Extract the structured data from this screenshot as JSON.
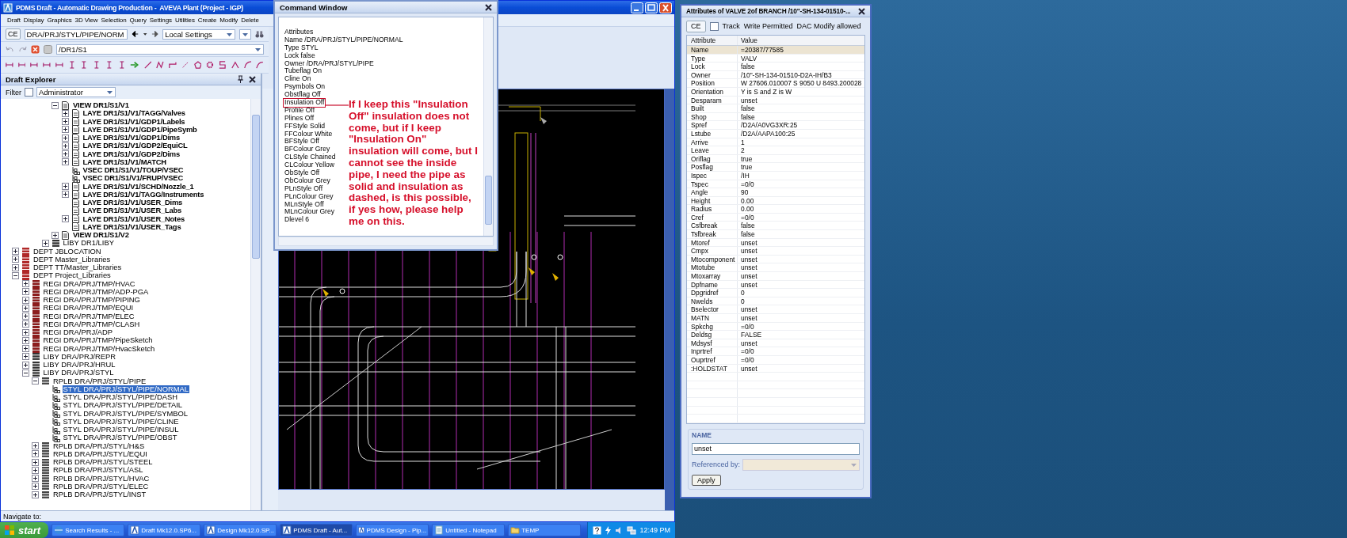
{
  "main_window": {
    "title": "PDMS Draft - Automatic Drawing Production -  AVEVA Plant (Project - IGP)",
    "menu": [
      "Draft",
      "Display",
      "Graphics",
      "3D View",
      "Selection",
      "Query",
      "Settings",
      "Utilities",
      "Create",
      "Modify",
      "Delete"
    ],
    "toolbar": {
      "ce_button": "CE",
      "element_combo": "DRA/PRJ/STYL/PIPE/NORM",
      "settings_combo": "Local Settings",
      "path_combo": "/DR1/S1"
    },
    "draft_explorer": {
      "title": "Draft Explorer",
      "filter_label": "Filter",
      "filter_checked": false,
      "filter_combo": "Administrator",
      "tree": [
        {
          "children": [
            {
              "children": [
                {
                  "children": [
                    {
                      "children": [
                        {
                          "label": "VIEW DR1/S1/V1",
                          "kind": "view",
                          "selected": false,
                          "expanded": true,
                          "children": [
                            {
                              "label": "LAYE DR1/S1/V1/TAGG/Valves",
                              "kind": "layer",
                              "selected": false,
                              "expanded": false
                            },
                            {
                              "label": "LAYE DR1/S1/V1/GDP1/Labels",
                              "kind": "layer",
                              "selected": false,
                              "expanded": false
                            },
                            {
                              "label": "LAYE DR1/S1/V1/GDP1/PipeSymb",
                              "kind": "layer",
                              "selected": false,
                              "expanded": false
                            },
                            {
                              "label": "LAYE DR1/S1/V1/GDP1/Dims",
                              "kind": "layer",
                              "selected": false,
                              "expanded": false
                            },
                            {
                              "label": "LAYE DR1/S1/V1/GDP2/EquiCL",
                              "kind": "layer",
                              "selected": false,
                              "expanded": false
                            },
                            {
                              "label": "LAYE DR1/S1/V1/GDP2/Dims",
                              "kind": "layer",
                              "selected": false,
                              "expanded": false
                            },
                            {
                              "label": "LAYE DR1/S1/V1/MATCH",
                              "kind": "layer",
                              "selected": false,
                              "expanded": false
                            },
                            {
                              "label": "VSEC DR1/S1/V1/TOUP/VSEC",
                              "kind": "vsec",
                              "selected": false
                            },
                            {
                              "label": "VSEC DR1/S1/V1/FRUP/VSEC",
                              "kind": "vsec",
                              "selected": false
                            },
                            {
                              "label": "LAYE DR1/S1/V1/SCHD/Nozzle_1",
                              "kind": "layer",
                              "selected": false,
                              "expanded": false
                            },
                            {
                              "label": "LAYE DR1/S1/V1/TAGG/Instruments",
                              "kind": "layer",
                              "selected": false,
                              "expanded": false
                            },
                            {
                              "label": "LAYE DR1/S1/V1/USER_Dims",
                              "kind": "layer",
                              "selected": false
                            },
                            {
                              "label": "LAYE DR1/S1/V1/USER_Labs",
                              "kind": "layer",
                              "selected": false
                            },
                            {
                              "label": "LAYE DR1/S1/V1/USER_Notes",
                              "kind": "layer",
                              "selected": false,
                              "expanded": false
                            },
                            {
                              "label": "LAYE DR1/S1/V1/USER_Tags",
                              "kind": "layer",
                              "selected": false
                            }
                          ]
                        },
                        {
                          "label": "VIEW DR1/S1/V2",
                          "kind": "view",
                          "selected": false,
                          "expanded": false
                        }
                      ]
                    },
                    {
                      "label": "LIBY DR1/LIBY",
                      "kind": "liby",
                      "selected": false,
                      "expanded": false
                    }
                  ]
                }
              ]
            }
          ]
        },
        {
          "label": "DEPT JBLOCATION",
          "kind": "dept",
          "selected": false,
          "expanded": false
        },
        {
          "label": "DEPT Master_Libraries",
          "kind": "dept",
          "selected": false,
          "expanded": false
        },
        {
          "label": "DEPT TT/Master_Libraries",
          "kind": "dept",
          "selected": false,
          "expanded": false
        },
        {
          "label": "DEPT Project_Libraries",
          "kind": "dept",
          "selected": false,
          "expanded": true,
          "children": [
            {
              "label": "REGI DRA/PRJ/TMP/HVAC",
              "kind": "regi",
              "selected": false,
              "expanded": false
            },
            {
              "label": "REGI DRA/PRJ/TMP/ADP-PGA",
              "kind": "regi",
              "selected": false,
              "expanded": false
            },
            {
              "label": "REGI DRA/PRJ/TMP/PIPING",
              "kind": "regi",
              "selected": false,
              "expanded": false
            },
            {
              "label": "REGI DRA/PRJ/TMP/EQUI",
              "kind": "regi",
              "selected": false,
              "expanded": false
            },
            {
              "label": "REGI DRA/PRJ/TMP/ELEC",
              "kind": "regi",
              "selected": false,
              "expanded": false
            },
            {
              "label": "REGI DRA/PRJ/TMP/CLASH",
              "kind": "regi",
              "selected": false,
              "expanded": false
            },
            {
              "label": "REGI DRA/PRJ/ADP",
              "kind": "regi",
              "selected": false,
              "expanded": false
            },
            {
              "label": "REGI DRA/PRJ/TMP/PipeSketch",
              "kind": "regi",
              "selected": false,
              "expanded": false
            },
            {
              "label": "REGI DRA/PRJ/TMP/HvacSketch",
              "kind": "regi",
              "selected": false,
              "expanded": false
            },
            {
              "label": "LIBY DRA/PRJ/REPR",
              "kind": "liby",
              "selected": false,
              "expanded": false
            },
            {
              "label": "LIBY DRA/PRJ/HRUL",
              "kind": "liby",
              "selected": false,
              "expanded": false
            },
            {
              "label": "LIBY DRA/PRJ/STYL",
              "kind": "liby",
              "selected": false,
              "expanded": true,
              "children": [
                {
                  "label": "RPLB DRA/PRJ/STYL/PIPE",
                  "kind": "rplb",
                  "selected": false,
                  "expanded": true,
                  "children": [
                    {
                      "label": "STYL DRA/PRJ/STYL/PIPE/NORMAL",
                      "kind": "styl",
                      "selected": true
                    },
                    {
                      "label": "STYL DRA/PRJ/STYL/PIPE/DASH",
                      "kind": "styl",
                      "selected": false
                    },
                    {
                      "label": "STYL DRA/PRJ/STYL/PIPE/DETAIL",
                      "kind": "styl",
                      "selected": false
                    },
                    {
                      "label": "STYL DRA/PRJ/STYL/PIPE/SYMBOL",
                      "kind": "styl",
                      "selected": false
                    },
                    {
                      "label": "STYL DRA/PRJ/STYL/PIPE/CLINE",
                      "kind": "styl",
                      "selected": false
                    },
                    {
                      "label": "STYL DRA/PRJ/STYL/PIPE/INSUL",
                      "kind": "styl",
                      "selected": false
                    },
                    {
                      "label": "STYL DRA/PRJ/STYL/PIPE/OBST",
                      "kind": "styl",
                      "selected": false
                    }
                  ]
                },
                {
                  "label": "RPLB DRA/PRJ/STYL/H&S",
                  "kind": "rplb",
                  "selected": false,
                  "expanded": false
                },
                {
                  "label": "RPLB DRA/PRJ/STYL/EQUI",
                  "kind": "rplb",
                  "selected": false,
                  "expanded": false
                },
                {
                  "label": "RPLB DRA/PRJ/STYL/STEEL",
                  "kind": "rplb",
                  "selected": false,
                  "expanded": false
                },
                {
                  "label": "RPLB DRA/PRJ/STYL/ASL",
                  "kind": "rplb",
                  "selected": false,
                  "expanded": false
                },
                {
                  "label": "RPLB DRA/PRJ/STYL/HVAC",
                  "kind": "rplb",
                  "selected": false,
                  "expanded": false
                },
                {
                  "label": "RPLB DRA/PRJ/STYL/ELEC",
                  "kind": "rplb",
                  "selected": false,
                  "expanded": false
                },
                {
                  "label": "RPLB DRA/PRJ/STYL/INST",
                  "kind": "rplb",
                  "selected": false,
                  "expanded": false
                }
              ]
            }
          ]
        }
      ]
    },
    "status_bar": "Navigate to:"
  },
  "command_window": {
    "title": "Command Window",
    "lines": [
      {
        "text": "Attributes",
        "boxed": false
      },
      {
        "text": "Name /DRA/PRJ/STYL/PIPE/NORMAL",
        "boxed": false
      },
      {
        "text": "Type STYL",
        "boxed": false
      },
      {
        "text": "Lock false",
        "boxed": false
      },
      {
        "text": "Owner /DRA/PRJ/STYL/PIPE",
        "boxed": false
      },
      {
        "text": "Tubeflag On",
        "boxed": false
      },
      {
        "text": "Cline On",
        "boxed": false
      },
      {
        "text": "Psymbols On",
        "boxed": false
      },
      {
        "text": "Obstflag Off",
        "boxed": false
      },
      {
        "text": "Insulation Off",
        "boxed": true
      },
      {
        "text": "Profile Off",
        "boxed": false
      },
      {
        "text": "Plines Off",
        "boxed": false
      },
      {
        "text": "FFStyle Solid",
        "boxed": false
      },
      {
        "text": "FFColour White",
        "boxed": false
      },
      {
        "text": "BFStyle Off",
        "boxed": false
      },
      {
        "text": "BFColour Grey",
        "boxed": false
      },
      {
        "text": "CLStyle Chained",
        "boxed": false
      },
      {
        "text": "CLColour Yellow",
        "boxed": false
      },
      {
        "text": "ObStyle Off",
        "boxed": false
      },
      {
        "text": "ObColour Grey",
        "boxed": false
      },
      {
        "text": "PLnStyle Off",
        "boxed": false
      },
      {
        "text": "PLnColour Grey",
        "boxed": false
      },
      {
        "text": "MLnStyle Off",
        "boxed": false
      },
      {
        "text": "MLnColour Grey",
        "boxed": false
      },
      {
        "text": "Dlevel 6",
        "boxed": false
      }
    ],
    "annotation": "If I keep this \"Insulation Off\" insulation does not come, but if I keep \"Insulation On\" insulation will come, but I cannot see the inside pipe, I need the pipe as solid and insulation as dashed, is this possible, if yes how, please help me on this."
  },
  "attributes_window": {
    "title": "Attributes of VALVE 2of BRANCH /10\"-SH-134-01510-...",
    "ce_button": "CE",
    "track_label": "Track",
    "track_checked": false,
    "write_status": "Write Permitted",
    "dac_status": "DAC Modify allowed",
    "columns": [
      "Attribute",
      "Value"
    ],
    "rows": [
      {
        "attribute": "Name",
        "value": "=20387/77585",
        "selected": true
      },
      {
        "attribute": "Type",
        "value": "VALV",
        "selected": false
      },
      {
        "attribute": "Lock",
        "value": "false",
        "selected": false
      },
      {
        "attribute": "Owner",
        "value": "/10\"-SH-134-01510-D2A-IH/B3",
        "selected": false
      },
      {
        "attribute": "Position",
        "value": "W 27606.010007 S 9050 U 8493.200028",
        "selected": false
      },
      {
        "attribute": "Orientation",
        "value": "Y is S and Z is W",
        "selected": false
      },
      {
        "attribute": "Desparam",
        "value": "unset",
        "selected": false
      },
      {
        "attribute": "Built",
        "value": "false",
        "selected": false
      },
      {
        "attribute": "Shop",
        "value": "false",
        "selected": false
      },
      {
        "attribute": "Spref",
        "value": "/D2A/A0VG3XR:25",
        "selected": false
      },
      {
        "attribute": "Lstube",
        "value": "/D2A/AAPA100:25",
        "selected": false
      },
      {
        "attribute": "Arrive",
        "value": "1",
        "selected": false
      },
      {
        "attribute": "Leave",
        "value": "2",
        "selected": false
      },
      {
        "attribute": "Oriflag",
        "value": "true",
        "selected": false
      },
      {
        "attribute": "Posflag",
        "value": "true",
        "selected": false
      },
      {
        "attribute": "Ispec",
        "value": "/IH",
        "selected": false
      },
      {
        "attribute": "Tspec",
        "value": "=0/0",
        "selected": false
      },
      {
        "attribute": "Angle",
        "value": "90",
        "selected": false
      },
      {
        "attribute": "Height",
        "value": "0.00",
        "selected": false
      },
      {
        "attribute": "Radius",
        "value": "0.00",
        "selected": false
      },
      {
        "attribute": "Cref",
        "value": "=0/0",
        "selected": false
      },
      {
        "attribute": "Csfbreak",
        "value": "false",
        "selected": false
      },
      {
        "attribute": "Tsfbreak",
        "value": "false",
        "selected": false
      },
      {
        "attribute": "Mtoref",
        "value": "unset",
        "selected": false
      },
      {
        "attribute": "Cmpx",
        "value": "unset",
        "selected": false
      },
      {
        "attribute": "Mtocomponent",
        "value": "unset",
        "selected": false
      },
      {
        "attribute": "Mtotube",
        "value": "unset",
        "selected": false
      },
      {
        "attribute": "Mtoxarray",
        "value": "unset",
        "selected": false
      },
      {
        "attribute": "Dpfname",
        "value": "unset",
        "selected": false
      },
      {
        "attribute": "Dpgridref",
        "value": "0",
        "selected": false
      },
      {
        "attribute": "Nwelds",
        "value": "0",
        "selected": false
      },
      {
        "attribute": "Bselector",
        "value": "unset",
        "selected": false
      },
      {
        "attribute": "MATN",
        "value": "unset",
        "selected": false
      },
      {
        "attribute": "Spkchg",
        "value": "=0/0",
        "selected": false
      },
      {
        "attribute": "Deldsg",
        "value": "FALSE",
        "selected": false
      },
      {
        "attribute": "Mdsysf",
        "value": "unset",
        "selected": false
      },
      {
        "attribute": "Inprtref",
        "value": "=0/0",
        "selected": false
      },
      {
        "attribute": "Ouprtref",
        "value": "=0/0",
        "selected": false
      },
      {
        "attribute": ":HOLDSTAT",
        "value": "unset",
        "selected": false
      }
    ],
    "name_group": {
      "legend": "NAME",
      "value": "unset",
      "referenced_label": "Referenced by:",
      "referenced_disabled": true,
      "apply_button": "Apply"
    }
  },
  "taskbar": {
    "start": "start",
    "tasks": [
      {
        "label": "Search Results - ...",
        "kind": "browser",
        "active": false
      },
      {
        "label": "Draft Mk12.0.SP6...",
        "kind": "app",
        "active": false
      },
      {
        "label": "Design Mk12.0.SP...",
        "kind": "app",
        "active": false
      },
      {
        "label": "PDMS Draft - Aut...",
        "kind": "app",
        "active": true
      },
      {
        "label": "PDMS Design - Pip...",
        "kind": "app",
        "active": false
      },
      {
        "label": "Untitled - Notepad",
        "kind": "notepad",
        "active": false
      },
      {
        "label": "TEMP",
        "kind": "folder",
        "active": false
      }
    ],
    "clock": "12:49 PM"
  }
}
